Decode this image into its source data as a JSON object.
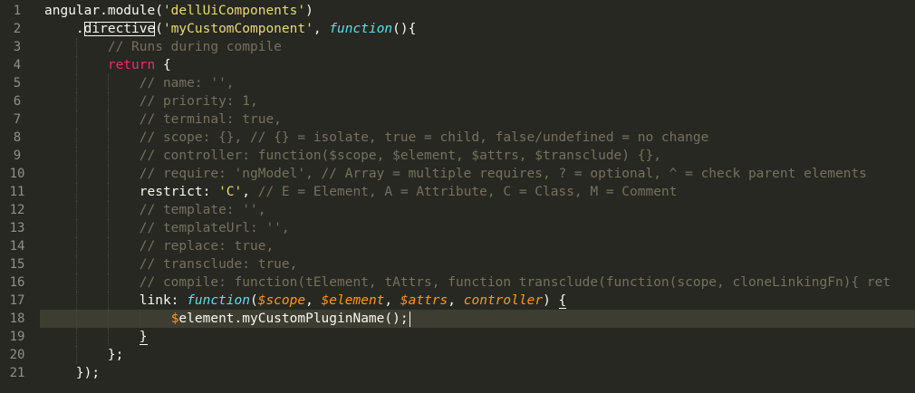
{
  "editor": {
    "line_numbers": [
      "1",
      "2",
      "3",
      "4",
      "5",
      "6",
      "7",
      "8",
      "9",
      "10",
      "11",
      "12",
      "13",
      "14",
      "15",
      "16",
      "17",
      "18",
      "19",
      "20",
      "21"
    ],
    "current_line": 18,
    "colors": {
      "background": "#272822",
      "current_line": "#3e3d32",
      "gutter_text": "#8f908a",
      "plain": "#f8f8f2",
      "string": "#e6db74",
      "keyword": "#f92672",
      "storage": "#66d9ef",
      "parameter": "#fd971f",
      "comment": "#75715e"
    },
    "lines": [
      [
        {
          "t": "plain",
          "v": "angular.module("
        },
        {
          "t": "string",
          "v": "'dellUiComponents'"
        },
        {
          "t": "plain",
          "v": ")"
        }
      ],
      [
        {
          "t": "plain",
          "v": "    ."
        },
        {
          "t": "plain",
          "v": "directive",
          "outlined": true
        },
        {
          "t": "plain",
          "v": "("
        },
        {
          "t": "string",
          "v": "'myCustomComponent'"
        },
        {
          "t": "plain",
          "v": ", "
        },
        {
          "t": "storage",
          "v": "function"
        },
        {
          "t": "plain",
          "v": "(){"
        }
      ],
      [
        {
          "t": "plain",
          "v": "        "
        },
        {
          "t": "comment",
          "v": "// Runs during compile"
        }
      ],
      [
        {
          "t": "plain",
          "v": "        "
        },
        {
          "t": "keyword",
          "v": "return"
        },
        {
          "t": "plain",
          "v": " {"
        }
      ],
      [
        {
          "t": "plain",
          "v": "            "
        },
        {
          "t": "comment",
          "v": "// name: '',"
        }
      ],
      [
        {
          "t": "plain",
          "v": "            "
        },
        {
          "t": "comment",
          "v": "// priority: 1,"
        }
      ],
      [
        {
          "t": "plain",
          "v": "            "
        },
        {
          "t": "comment",
          "v": "// terminal: true,"
        }
      ],
      [
        {
          "t": "plain",
          "v": "            "
        },
        {
          "t": "comment",
          "v": "// scope: {}, // {} = isolate, true = child, false/undefined = no change"
        }
      ],
      [
        {
          "t": "plain",
          "v": "            "
        },
        {
          "t": "comment",
          "v": "// controller: function($scope, $element, $attrs, $transclude) {},"
        }
      ],
      [
        {
          "t": "plain",
          "v": "            "
        },
        {
          "t": "comment",
          "v": "// require: 'ngModel', // Array = multiple requires, ? = optional, ^ = check parent elements"
        }
      ],
      [
        {
          "t": "plain",
          "v": "            restrict: "
        },
        {
          "t": "string",
          "v": "'C'"
        },
        {
          "t": "plain",
          "v": ", "
        },
        {
          "t": "comment",
          "v": "// E = Element, A = Attribute, C = Class, M = Comment"
        }
      ],
      [
        {
          "t": "plain",
          "v": "            "
        },
        {
          "t": "comment",
          "v": "// template: '',"
        }
      ],
      [
        {
          "t": "plain",
          "v": "            "
        },
        {
          "t": "comment",
          "v": "// templateUrl: '',"
        }
      ],
      [
        {
          "t": "plain",
          "v": "            "
        },
        {
          "t": "comment",
          "v": "// replace: true,"
        }
      ],
      [
        {
          "t": "plain",
          "v": "            "
        },
        {
          "t": "comment",
          "v": "// transclude: true,"
        }
      ],
      [
        {
          "t": "plain",
          "v": "            "
        },
        {
          "t": "comment",
          "v": "// compile: function(tElement, tAttrs, function transclude(function(scope, cloneLinkingFn){ ret"
        }
      ],
      [
        {
          "t": "plain",
          "v": "            link: "
        },
        {
          "t": "storage",
          "v": "function"
        },
        {
          "t": "plain",
          "v": "("
        },
        {
          "t": "param",
          "v": "$scope"
        },
        {
          "t": "plain",
          "v": ", "
        },
        {
          "t": "param",
          "v": "$element"
        },
        {
          "t": "plain",
          "v": ", "
        },
        {
          "t": "param",
          "v": "$attrs"
        },
        {
          "t": "plain",
          "v": ", "
        },
        {
          "t": "param",
          "v": "controller"
        },
        {
          "t": "plain",
          "v": ") "
        },
        {
          "t": "plain",
          "v": "{",
          "match": true
        }
      ],
      [
        {
          "t": "plain",
          "v": "                "
        },
        {
          "t": "param_plain",
          "v": "$"
        },
        {
          "t": "plain",
          "v": "element.myCustomPluginName();"
        },
        {
          "t": "caret",
          "v": ""
        }
      ],
      [
        {
          "t": "plain",
          "v": "            "
        },
        {
          "t": "plain",
          "v": "}",
          "match": true
        }
      ],
      [
        {
          "t": "plain",
          "v": "        };"
        }
      ],
      [
        {
          "t": "plain",
          "v": "    });"
        }
      ]
    ]
  }
}
